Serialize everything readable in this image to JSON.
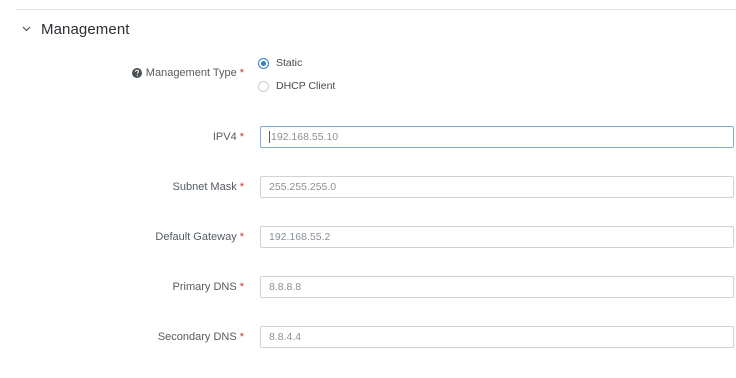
{
  "section": {
    "title": "Management",
    "chevron_icon": "chevron-down-icon"
  },
  "management_type": {
    "label": "Management Type",
    "required_mark": "*",
    "help_icon": "question-circle-icon",
    "options": [
      {
        "label": "Static",
        "selected": true
      },
      {
        "label": "DHCP Client",
        "selected": false
      }
    ]
  },
  "fields": {
    "ipv4": {
      "label": "IPV4",
      "required_mark": "*",
      "value": "192.168.55.10"
    },
    "subnet_mask": {
      "label": "Subnet Mask",
      "required_mark": "*",
      "value": "255.255.255.0"
    },
    "default_gateway": {
      "label": "Default Gateway",
      "required_mark": "*",
      "value": "192.168.55.2"
    },
    "primary_dns": {
      "label": "Primary DNS",
      "required_mark": "*",
      "value": "8.8.8.8"
    },
    "secondary_dns": {
      "label": "Secondary DNS",
      "required_mark": "*",
      "value": "8.8.4.4"
    }
  },
  "colors": {
    "accent": "#2f7fd1",
    "required": "#d0312d",
    "focus_border": "#7db0de"
  }
}
